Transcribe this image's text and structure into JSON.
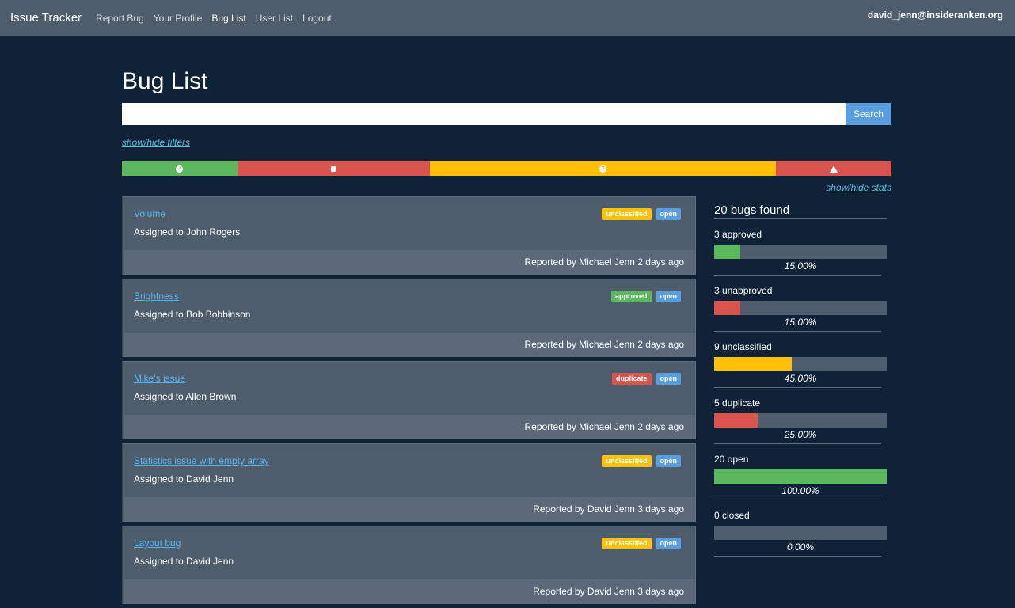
{
  "navbar": {
    "brand": "Issue Tracker",
    "links": [
      "Report Bug",
      "Your Profile",
      "Bug List",
      "User List",
      "Logout"
    ],
    "active": "Bug List",
    "user": "david_jenn@insideranken.org"
  },
  "page": {
    "title": "Bug List",
    "search_value": "",
    "search_button": "Search",
    "filters_link": "show/hide filters",
    "stats_link": "show/hide stats"
  },
  "stats_bar": [
    {
      "name": "approved",
      "fraction": 0.15,
      "color": "#5cb85c",
      "icon": "check-circle-icon"
    },
    {
      "name": "unapproved",
      "fraction": 0.25,
      "color": "#d9534f",
      "icon": "copy-icon"
    },
    {
      "name": "unclassified",
      "fraction": 0.45,
      "color": "#ffc107",
      "icon": "question-circle-icon"
    },
    {
      "name": "duplicate",
      "fraction": 0.15,
      "color": "#d9534f",
      "icon": "warning-icon"
    }
  ],
  "bugs": [
    {
      "title": "Volume",
      "assigned": "Assigned to John Rogers",
      "badges": [
        "unclassified",
        "open"
      ],
      "reported": "Reported by Michael Jenn 2 days ago"
    },
    {
      "title": "Brightness",
      "assigned": "Assigned to Bob Bobbinson",
      "badges": [
        "approved",
        "open"
      ],
      "reported": "Reported by Michael Jenn 2 days ago"
    },
    {
      "title": "Mike's issue",
      "assigned": "Assigned to Allen Brown",
      "badges": [
        "duplicate",
        "open"
      ],
      "reported": "Reported by Michael Jenn 2 days ago"
    },
    {
      "title": "Statistics issue with empty array",
      "assigned": "Assigned to David Jenn",
      "badges": [
        "unclassified",
        "open"
      ],
      "reported": "Reported by David Jenn 3 days ago"
    },
    {
      "title": "Layout bug",
      "assigned": "Assigned to David Jenn",
      "badges": [
        "unclassified",
        "open"
      ],
      "reported": "Reported by David Jenn 3 days ago"
    }
  ],
  "stats": {
    "heading": "20 bugs found",
    "items": [
      {
        "label": "3 approved",
        "percent": 15,
        "percent_text": "15.00%",
        "color": "#5cb85c"
      },
      {
        "label": "3 unapproved",
        "percent": 15,
        "percent_text": "15.00%",
        "color": "#d9534f"
      },
      {
        "label": "9 unclassified",
        "percent": 45,
        "percent_text": "45.00%",
        "color": "#ffc107"
      },
      {
        "label": "5 duplicate",
        "percent": 25,
        "percent_text": "25.00%",
        "color": "#d9534f"
      },
      {
        "label": "20 open",
        "percent": 100,
        "percent_text": "100.00%",
        "color": "#5cb85c"
      },
      {
        "label": "0 closed",
        "percent": 0,
        "percent_text": "0.00%",
        "color": "#5cb85c"
      }
    ]
  }
}
